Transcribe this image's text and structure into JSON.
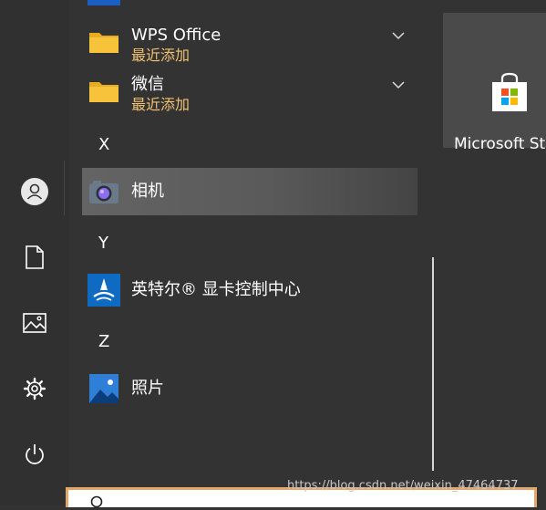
{
  "rail": {
    "items": [
      {
        "icon": "user-avatar-icon"
      },
      {
        "icon": "documents-icon"
      },
      {
        "icon": "pictures-icon"
      },
      {
        "icon": "settings-gear-icon"
      },
      {
        "icon": "power-icon"
      }
    ]
  },
  "apps": {
    "groups": [
      {
        "name": "WPS Office",
        "sub": "最近添加",
        "icon": "folder-icon",
        "color": "#f6c33b"
      },
      {
        "name": "微信",
        "sub": "最近添加",
        "icon": "folder-icon",
        "color": "#f6c33b"
      }
    ],
    "letters": [
      "X",
      "Y",
      "Z"
    ],
    "items": [
      {
        "name": "相机",
        "icon": "camera-icon"
      },
      {
        "name": "英特尔® 显卡控制中心",
        "icon": "intel-graphics-icon",
        "color": "#0f6bc1"
      },
      {
        "name": "照片",
        "icon": "photos-icon",
        "color": "#2f7fd8"
      }
    ]
  },
  "tiles": {
    "store_label": "Microsoft Store",
    "store_icon": "shopping-bag-icon"
  },
  "watermark": "https://blog.csdn.net/weixin_47464737",
  "colors": {
    "accent": "#f1c171",
    "search_border": "#e3a76b",
    "background": "#333333"
  }
}
